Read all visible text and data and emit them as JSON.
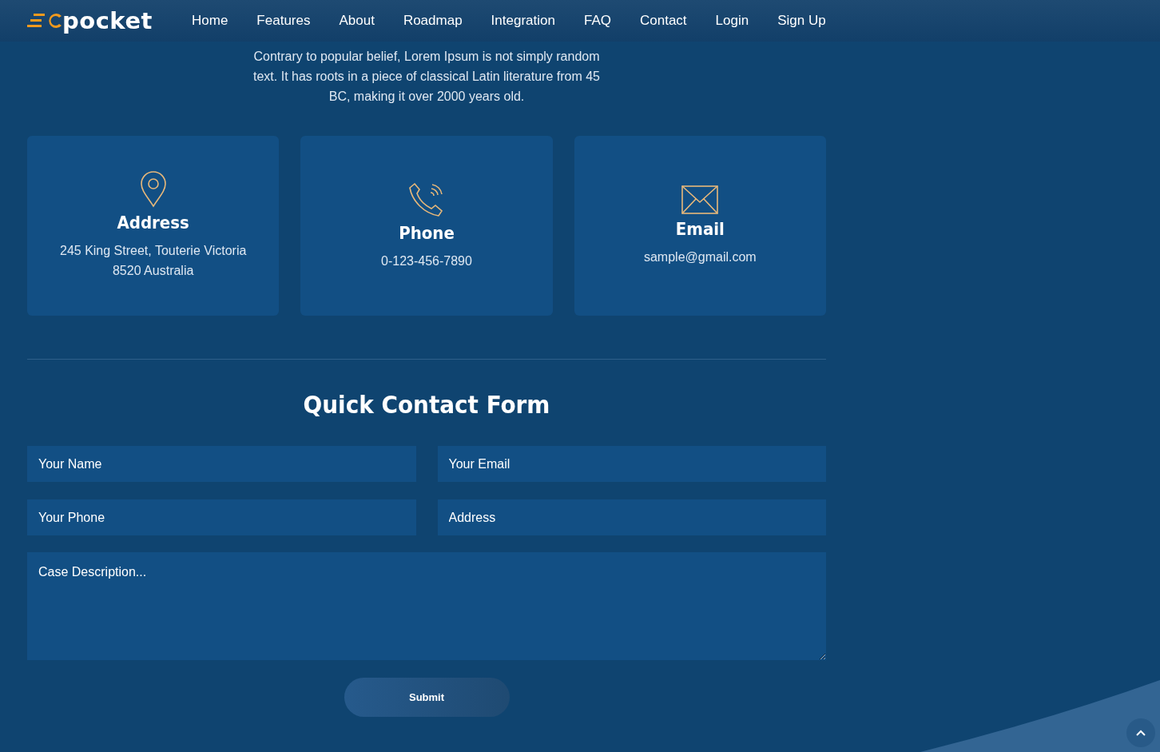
{
  "logo": {
    "text": "pocket"
  },
  "nav": [
    {
      "label": "Home"
    },
    {
      "label": "Features"
    },
    {
      "label": "About"
    },
    {
      "label": "Roadmap"
    },
    {
      "label": "Integration"
    },
    {
      "label": "FAQ"
    },
    {
      "label": "Contact"
    },
    {
      "label": "Login"
    },
    {
      "label": "Sign Up"
    }
  ],
  "intro": "Contrary to popular belief, Lorem Ipsum is not simply random text. It has roots in a piece of classical Latin literature from 45 BC, making it over 2000 years old.",
  "cards": [
    {
      "kind": "address",
      "title": "Address",
      "lines": [
        "245 King Street, Touterie Victoria",
        "8520 Australia"
      ]
    },
    {
      "kind": "phone",
      "title": "Phone",
      "lines": [
        "0-123-456-7890"
      ]
    },
    {
      "kind": "email",
      "title": "Email",
      "lines": [
        "sample@gmail.com"
      ]
    }
  ],
  "form": {
    "title": "Quick Contact Form",
    "fields": [
      {
        "placeholder": "Your Name"
      },
      {
        "placeholder": "Your Email"
      },
      {
        "placeholder": "Your Phone"
      },
      {
        "placeholder": "Address"
      }
    ],
    "message": {
      "placeholder": "Case Description..."
    },
    "submit": "Submit"
  }
}
